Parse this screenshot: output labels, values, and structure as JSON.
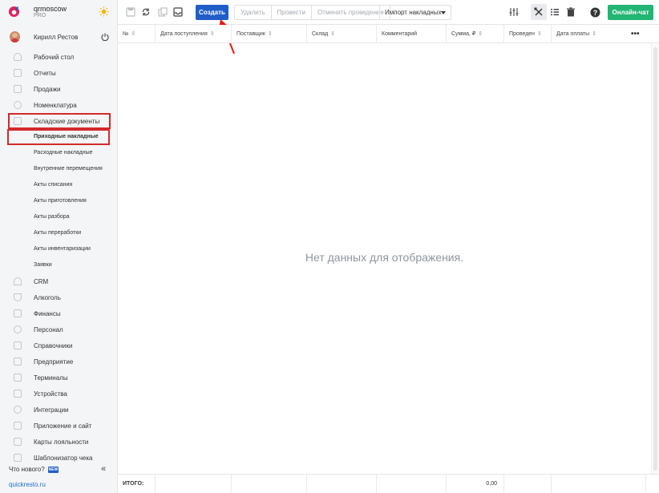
{
  "brand": {
    "name": "qrmoscow",
    "plan": "PRO"
  },
  "user": {
    "name": "Кирилл Рестов"
  },
  "nav": {
    "items": [
      {
        "label": "Рабочий стол",
        "icon": "dashboard-icon"
      },
      {
        "label": "Отчеты",
        "icon": "reports-icon"
      },
      {
        "label": "Продажи",
        "icon": "sales-icon"
      },
      {
        "label": "Номенклатура",
        "icon": "nomenclature-icon"
      },
      {
        "label": "Складские документы",
        "icon": "warehouse-icon"
      }
    ],
    "subitems": [
      {
        "label": "Приходные накладные"
      },
      {
        "label": "Расходные накладные"
      },
      {
        "label": "Внутренние перемещения"
      },
      {
        "label": "Акты списания"
      },
      {
        "label": "Акты приготовления"
      },
      {
        "label": "Акты разбора"
      },
      {
        "label": "Акты переработки"
      },
      {
        "label": "Акты инвентаризации"
      },
      {
        "label": "Заявки"
      }
    ],
    "items2": [
      {
        "label": "CRM",
        "icon": "crm-icon"
      },
      {
        "label": "Алкоголь",
        "icon": "alcohol-icon"
      },
      {
        "label": "Финансы",
        "icon": "finance-icon"
      },
      {
        "label": "Персонал",
        "icon": "staff-icon"
      },
      {
        "label": "Справочники",
        "icon": "directory-icon"
      },
      {
        "label": "Предприятие",
        "icon": "enterprise-icon"
      },
      {
        "label": "Терминалы",
        "icon": "terminal-icon"
      },
      {
        "label": "Устройства",
        "icon": "devices-icon"
      },
      {
        "label": "Интеграции",
        "icon": "integrations-icon"
      },
      {
        "label": "Приложение и сайт",
        "icon": "app-icon"
      },
      {
        "label": "Карты лояльности",
        "icon": "loyalty-icon"
      },
      {
        "label": "Шаблонизатор чека",
        "icon": "receipt-icon"
      }
    ]
  },
  "footer": {
    "whats_new": "Что нового?",
    "new_badge": "NEW",
    "collapse": "«",
    "site": "quickresto.ru"
  },
  "toolbar": {
    "create": "Создать",
    "delete": "Удалить",
    "post": "Провести",
    "unpost": "Отменить проведение",
    "import": "Импорт накладных",
    "chat": "Онлайн-чат"
  },
  "table": {
    "columns": [
      "№",
      "Дата поступления",
      "Поставщик",
      "Склад",
      "Комментарий",
      "Сумма, ₽",
      "Проведен",
      "Дата оплаты"
    ],
    "more": "•••",
    "empty": "Нет данных для отображения.",
    "total_label": "ИТОГО:",
    "total_sum": "0,00"
  },
  "colors": {
    "primary": "#1f5ec8",
    "chat": "#22b573",
    "highlight": "#d42a2a"
  }
}
